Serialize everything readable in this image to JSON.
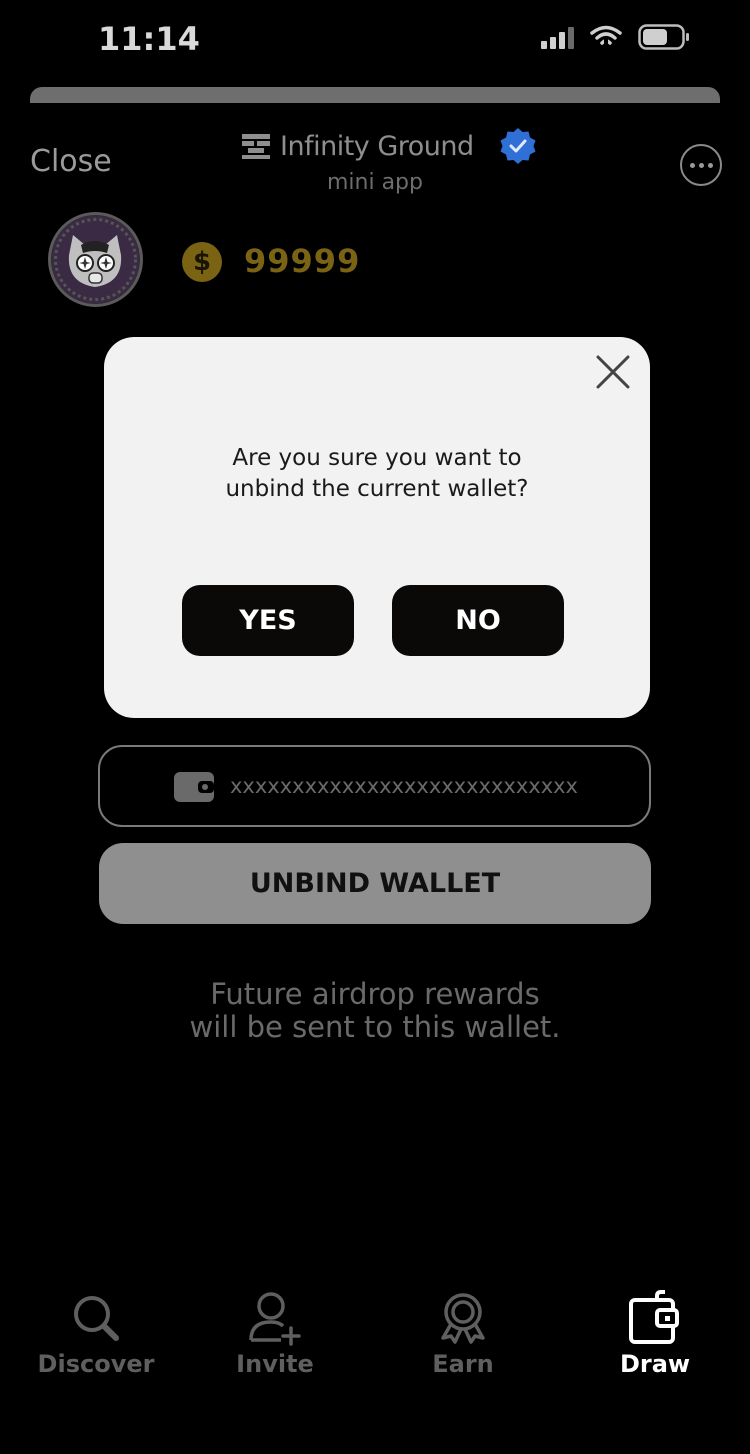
{
  "status_bar": {
    "time": "11:14"
  },
  "header": {
    "close_label": "Close",
    "app_name": "Infinity Ground",
    "app_subtitle": "mini app"
  },
  "profile": {
    "balance": "99999",
    "coin_symbol": "$"
  },
  "dialog": {
    "message_line1": "Are you sure you want to",
    "message_line2": "unbind the current wallet?",
    "yes_label": "YES",
    "no_label": "NO"
  },
  "wallet": {
    "address": "xxxxxxxxxxxxxxxxxxxxxxxxxxxx",
    "unbind_label": "UNBIND WALLET",
    "info_line1": "Future airdrop rewards",
    "info_line2": "will be sent to this wallet."
  },
  "tabs": [
    {
      "label": "Discover",
      "icon": "search-icon",
      "active": false
    },
    {
      "label": "Invite",
      "icon": "add-user-icon",
      "active": false
    },
    {
      "label": "Earn",
      "icon": "award-icon",
      "active": false
    },
    {
      "label": "Draw",
      "icon": "wallet-icon",
      "active": true
    }
  ],
  "colors": {
    "background": "#000000",
    "dialog_bg": "#f2f2f2",
    "button_dark": "#0b0808",
    "coin_gold": "#7a6414",
    "verified_blue": "#2f6fd6"
  }
}
